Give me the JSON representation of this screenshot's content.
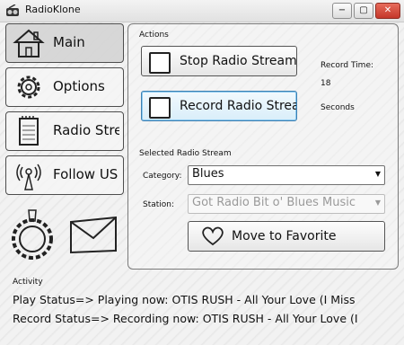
{
  "window": {
    "title": "RadioKlone",
    "minimize": "−",
    "maximize": "▢",
    "close": "✕"
  },
  "nav": {
    "items": [
      {
        "label": "Main",
        "icon": "house-icon",
        "active": true
      },
      {
        "label": "Options",
        "icon": "gear-icon",
        "active": false
      },
      {
        "label": "Radio Strea",
        "icon": "notepad-icon",
        "active": false
      },
      {
        "label": "Follow US",
        "icon": "broadcast-tower-icon",
        "active": false
      }
    ],
    "bottom_icons": [
      "bottlecap-icon",
      "envelope-icon"
    ]
  },
  "actions": {
    "section_label": "Actions",
    "stop_button": "Stop Radio Stream",
    "record_button": "Record Radio Strea",
    "record_time_label": "Record Time:",
    "record_time_value": "18",
    "record_time_unit": "Seconds"
  },
  "selected_stream": {
    "section_label": "Selected Radio Stream",
    "category_label": "Category:",
    "category_value": "Blues",
    "station_label": "Station:",
    "station_value": "Got Radio Bit o' Blues Music",
    "favorite_button": "Move to Favorite"
  },
  "activity": {
    "label": "Activity",
    "play_status": "Play Status=> Playing now: OTIS RUSH - All Your Love (I Miss",
    "record_status": "Record Status=> Recording now: OTIS RUSH - All Your Love (I"
  }
}
